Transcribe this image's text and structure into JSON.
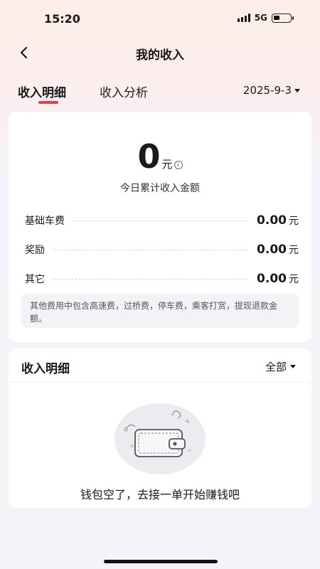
{
  "status_bar": {
    "time": "15:20",
    "network": "5G",
    "icons": [
      "signal-icon",
      "battery-icon"
    ]
  },
  "nav": {
    "title": "我的收入",
    "back_icon": "chevron-left-icon"
  },
  "tabs": [
    {
      "label": "收入明细",
      "active": true
    },
    {
      "label": "收入分析",
      "active": false
    }
  ],
  "date_picker": {
    "value": "2025-9-3"
  },
  "summary": {
    "amount": "0",
    "unit": "元",
    "info_symbol": "i",
    "label": "今日累计收入金额",
    "items": [
      {
        "label": "基础车费",
        "value": "0.00",
        "unit": "元"
      },
      {
        "label": "奖励",
        "value": "0.00",
        "unit": "元"
      },
      {
        "label": "其它",
        "value": "0.00",
        "unit": "元"
      }
    ],
    "note": "其他费用中包含高速费，过桥费，停车费，乘客打赏，提现退款金额。"
  },
  "income_detail": {
    "title": "收入明细",
    "filter": "全部",
    "empty_text": "钱包空了，去接一单开始赚钱吧"
  },
  "colors": {
    "accent": "#e8404a",
    "background": "#f4f4f8",
    "card": "#ffffff"
  }
}
